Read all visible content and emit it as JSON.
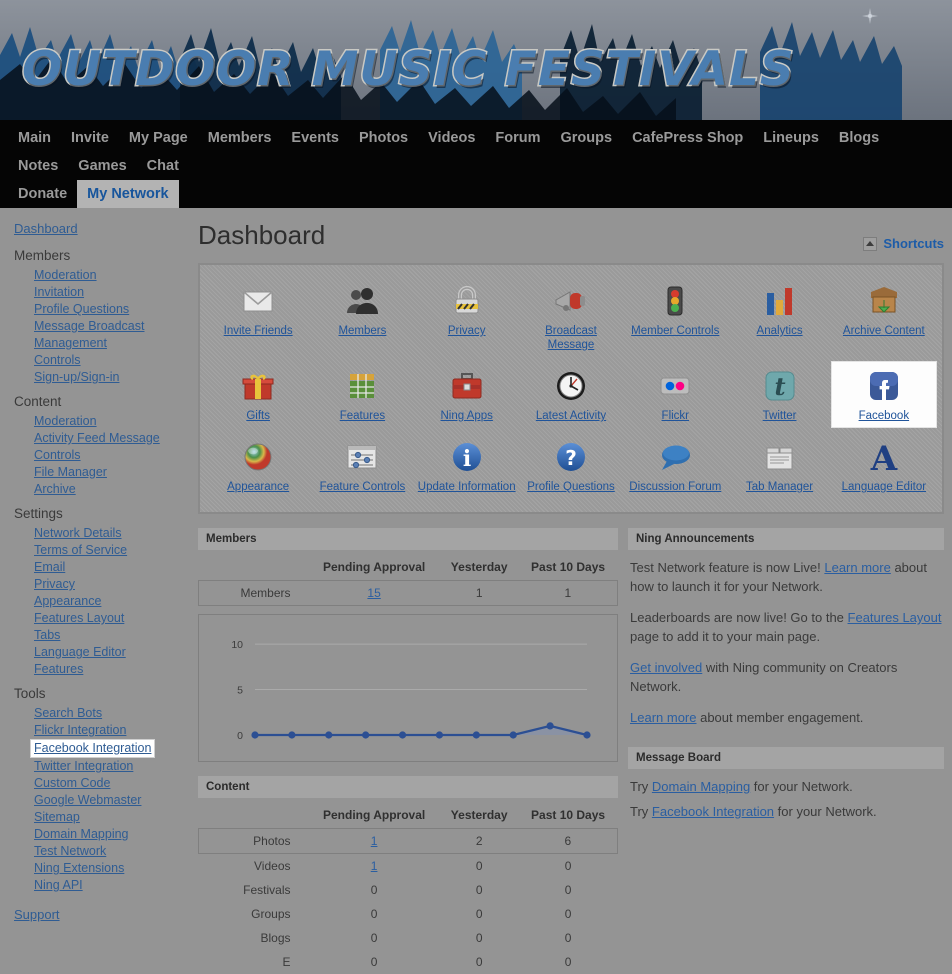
{
  "banner": {
    "title": "OUTDOOR MUSIC FESTIVALS"
  },
  "nav": {
    "items": [
      {
        "label": "Main",
        "active": false
      },
      {
        "label": "Invite",
        "active": false
      },
      {
        "label": "My Page",
        "active": false
      },
      {
        "label": "Members",
        "active": false
      },
      {
        "label": "Events",
        "active": false
      },
      {
        "label": "Photos",
        "active": false
      },
      {
        "label": "Videos",
        "active": false
      },
      {
        "label": "Forum",
        "active": false
      },
      {
        "label": "Groups",
        "active": false
      },
      {
        "label": "CafePress Shop",
        "active": false
      },
      {
        "label": "Lineups",
        "active": false
      },
      {
        "label": "Blogs",
        "active": false
      },
      {
        "label": "Notes",
        "active": false
      },
      {
        "label": "Games",
        "active": false
      },
      {
        "label": "Chat",
        "active": false
      },
      {
        "label": "Donate",
        "active": false
      },
      {
        "label": "My Network",
        "active": true
      }
    ]
  },
  "sidebar": {
    "dashboard": "Dashboard",
    "support": "Support",
    "groups": [
      {
        "title": "Members",
        "items": [
          "Moderation",
          "Invitation",
          "Profile Questions",
          "Message Broadcast",
          "Management",
          "Controls",
          "Sign-up/Sign-in"
        ]
      },
      {
        "title": "Content",
        "items": [
          "Moderation",
          "Activity Feed Message",
          "Controls",
          "File Manager",
          "Archive"
        ]
      },
      {
        "title": "Settings",
        "items": [
          "Network Details",
          "Terms of Service",
          "Email",
          "Privacy",
          "Appearance",
          "Features Layout",
          "Tabs",
          "Language Editor",
          "Features"
        ]
      },
      {
        "title": "Tools",
        "items": [
          "Search Bots",
          "Flickr Integration",
          "Facebook Integration",
          "Twitter Integration",
          "Custom Code",
          "Google Webmaster",
          "Sitemap",
          "Domain Mapping",
          "Test Network",
          "Ning Extensions",
          "Ning API"
        ],
        "highlight": "Facebook Integration"
      }
    ]
  },
  "main": {
    "page_title": "Dashboard",
    "shortcuts_label": "Shortcuts",
    "shortcuts_icon": "collapse-triangle-icon"
  },
  "icon_grid": [
    {
      "label": "Invite Friends",
      "icon": "envelope-icon",
      "selected": false
    },
    {
      "label": "Members",
      "icon": "people-icon",
      "selected": false
    },
    {
      "label": "Privacy",
      "icon": "padlock-icon",
      "selected": false
    },
    {
      "label": "Broadcast Message",
      "icon": "megaphone-icon",
      "selected": false
    },
    {
      "label": "Member Controls",
      "icon": "traffic-light-icon",
      "selected": false
    },
    {
      "label": "Analytics",
      "icon": "bar-chart-icon",
      "selected": false
    },
    {
      "label": "Archive Content",
      "icon": "archive-box-icon",
      "selected": false
    },
    {
      "label": "Gifts",
      "icon": "gift-icon",
      "selected": false
    },
    {
      "label": "Features",
      "icon": "grid-blocks-icon",
      "selected": false
    },
    {
      "label": "Ning Apps",
      "icon": "toolbox-icon",
      "selected": false
    },
    {
      "label": "Latest Activity",
      "icon": "clock-icon",
      "selected": false
    },
    {
      "label": "Flickr",
      "icon": "flickr-dots-icon",
      "selected": false
    },
    {
      "label": "Twitter",
      "icon": "twitter-bird-icon",
      "selected": false
    },
    {
      "label": "Facebook",
      "icon": "facebook-f-icon",
      "selected": true
    },
    {
      "label": "Appearance",
      "icon": "color-sphere-icon",
      "selected": false
    },
    {
      "label": "Feature Controls",
      "icon": "sliders-icon",
      "selected": false
    },
    {
      "label": "Update Information",
      "icon": "info-circle-icon",
      "selected": false
    },
    {
      "label": "Profile Questions",
      "icon": "question-circle-icon",
      "selected": false
    },
    {
      "label": "Discussion Forum",
      "icon": "speech-bubble-icon",
      "selected": false
    },
    {
      "label": "Tab Manager",
      "icon": "tabs-icon",
      "selected": false
    },
    {
      "label": "Language Editor",
      "icon": "letter-a-icon",
      "selected": false
    }
  ],
  "members_section": {
    "title": "Members",
    "columns": [
      "",
      "Pending Approval",
      "Yesterday",
      "Past 10 Days"
    ],
    "rows": [
      {
        "name": "Members",
        "pending": "15",
        "pending_link": true,
        "yesterday": "1",
        "past10": "1",
        "boxed": true
      }
    ]
  },
  "content_section": {
    "title": "Content",
    "columns": [
      "",
      "Pending Approval",
      "Yesterday",
      "Past 10 Days"
    ],
    "rows": [
      {
        "name": "Photos",
        "pending": "1",
        "pending_link": true,
        "yesterday": "2",
        "past10": "6",
        "boxed": true
      },
      {
        "name": "Videos",
        "pending": "1",
        "pending_link": true,
        "yesterday": "0",
        "past10": "0",
        "boxed": false
      },
      {
        "name": "Festivals",
        "pending": "0",
        "pending_link": false,
        "yesterday": "0",
        "past10": "0",
        "boxed": false
      },
      {
        "name": "Groups",
        "pending": "0",
        "pending_link": false,
        "yesterday": "0",
        "past10": "0",
        "boxed": false
      },
      {
        "name": "Blogs",
        "pending": "0",
        "pending_link": false,
        "yesterday": "0",
        "past10": "0",
        "boxed": false
      },
      {
        "name": "E",
        "pending": "0",
        "pending_link": false,
        "yesterday": "0",
        "past10": "0",
        "boxed": false
      }
    ]
  },
  "announcements": {
    "title": "Ning Announcements",
    "paragraphs": [
      [
        {
          "t": "Test Network feature is now Live! ",
          "link": false
        },
        {
          "t": "Learn more",
          "link": true
        },
        {
          "t": " about how to launch it for your Network.",
          "link": false
        }
      ],
      [
        {
          "t": "Leaderboards are now live! Go to the ",
          "link": false
        },
        {
          "t": "Features Layout",
          "link": true
        },
        {
          "t": " page to add it to your main page.",
          "link": false
        }
      ],
      [
        {
          "t": "Get involved",
          "link": true
        },
        {
          "t": " with Ning community on Creators Network.",
          "link": false
        }
      ],
      [
        {
          "t": "Learn more",
          "link": true
        },
        {
          "t": " about member engagement.",
          "link": false
        }
      ]
    ]
  },
  "message_board": {
    "title": "Message Board",
    "paragraphs": [
      [
        {
          "t": "Try ",
          "link": false
        },
        {
          "t": "Domain Mapping",
          "link": true
        },
        {
          "t": " for your Network.",
          "link": false
        }
      ],
      [
        {
          "t": "Try ",
          "link": false
        },
        {
          "t": "Facebook Integration",
          "link": true
        },
        {
          "t": " for your Network.",
          "link": false
        }
      ]
    ]
  },
  "chart_data": {
    "type": "line",
    "title": "Members",
    "xlabel": "",
    "ylabel": "",
    "x": [
      1,
      2,
      3,
      4,
      5,
      6,
      7,
      8,
      9,
      10
    ],
    "values": [
      0,
      0,
      0,
      0,
      0,
      0,
      0,
      0,
      1,
      0
    ],
    "ylim": [
      0,
      11
    ],
    "yticks": [
      0,
      5,
      10
    ],
    "ytick_labels": [
      "0",
      "5",
      "10"
    ],
    "grid": true,
    "legend": "none",
    "series_color": "#2c4f93",
    "fill_color": "#7f90b8"
  },
  "colors": {
    "page_bg": "#949494",
    "nav_bg": "#050505",
    "link": "#2a5ea1",
    "accent": "#17559c",
    "section_head_bg": "#a4a4a4"
  }
}
